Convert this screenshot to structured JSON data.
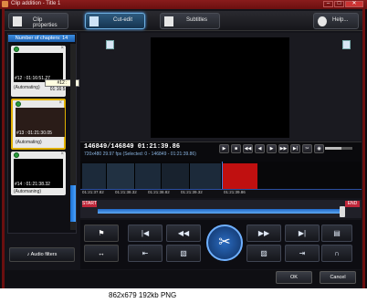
{
  "window": {
    "title": "Clip addition - Title 1",
    "min": "–",
    "max": "□",
    "close": "✕"
  },
  "toolbar": {
    "clip_properties": "Clip properties",
    "cut_edit": "Cut-edit",
    "subtitles": "Subtitles",
    "help": "Help..."
  },
  "chapters": {
    "header": "Number of chapters: 14",
    "items": [
      {
        "timecode": "#12 : 01:16:51.27",
        "note": "(Automating)"
      },
      {
        "timecode": "#13 : 01:21:30.05",
        "note": "(Automating)"
      },
      {
        "timecode": "#14 : 01:21:38.32",
        "note": "(Automaning)"
      }
    ],
    "tooltip": "#12 : 01:16:51.27"
  },
  "player": {
    "frame_counter": "146849/146849  01:21:39.86",
    "meta": "720x480 29.97 fps (Selected: 0 - 146849 - 01:21:39.86)"
  },
  "timeline": {
    "ticks": [
      "01:21:37.82",
      "01:21:38.32",
      "01:21:38.82",
      "01:21:39.32",
      "01:21:39.86"
    ],
    "start_label": "START",
    "end_label": "END"
  },
  "left_buttons": {
    "audio_filters": "Audio filters"
  },
  "dialog": {
    "ok": "OK",
    "cancel": "Cancel"
  },
  "caption": "862x679 192kb PNG",
  "colors": {
    "accent": "#3c8de0",
    "selection": "#c01010",
    "titlebar": "#8a1c1c"
  }
}
